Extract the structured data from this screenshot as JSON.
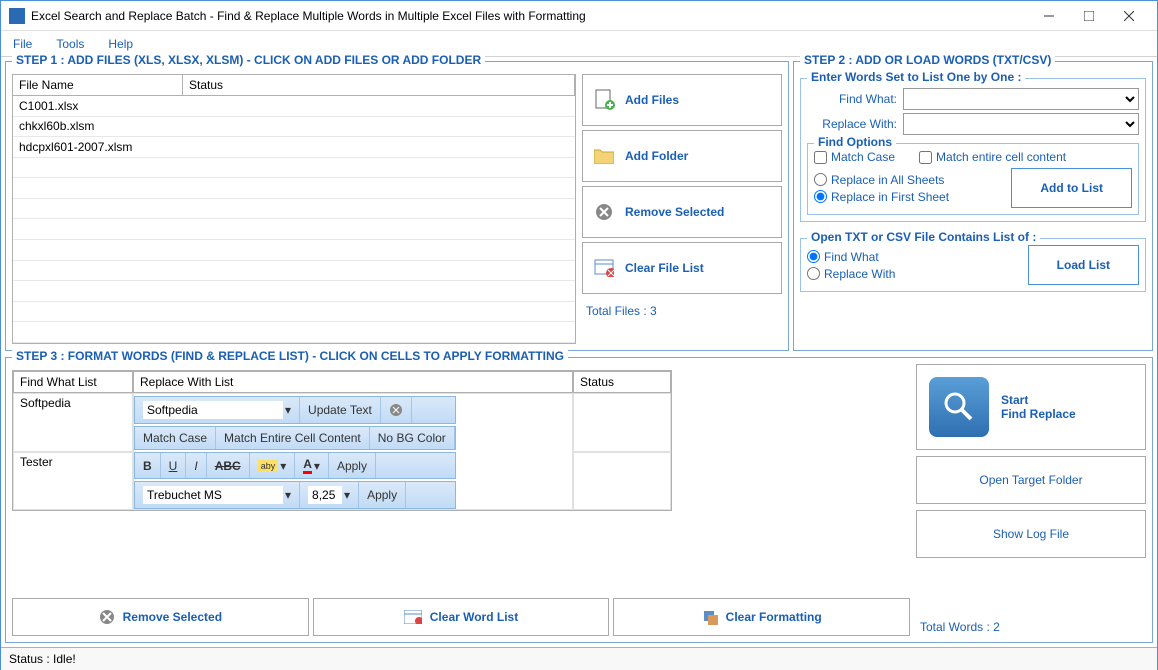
{
  "window": {
    "title": "Excel Search and Replace Batch - Find & Replace Multiple Words in Multiple Excel Files with Formatting"
  },
  "menu": [
    "File",
    "Tools",
    "Help"
  ],
  "step1": {
    "title": "STEP 1 : ADD FILES (XLS, XLSX, XLSM) - CLICK ON ADD FILES OR ADD FOLDER",
    "cols": [
      "File Name",
      "Status"
    ],
    "rows": [
      {
        "name": "C1001.xlsx",
        "status": ""
      },
      {
        "name": "chkxl60b.xlsm",
        "status": ""
      },
      {
        "name": "hdcpxl601-2007.xlsm",
        "status": ""
      }
    ],
    "btns": {
      "add_files": "Add Files",
      "add_folder": "Add Folder",
      "remove": "Remove Selected",
      "clear": "Clear File List"
    },
    "total": "Total Files : 3"
  },
  "step2": {
    "title": "STEP 2 : ADD OR LOAD WORDS (TXT/CSV)",
    "enter_title": "Enter Words Set to List One by One :",
    "find_what": "Find What:",
    "replace_with": "Replace With:",
    "opts_title": "Find Options",
    "match_case": "Match Case",
    "match_entire": "Match entire cell content",
    "replace_all": "Replace in All Sheets",
    "replace_first": "Replace in First Sheet",
    "add_list": "Add to List",
    "open_title": "Open TXT or CSV File Contains List of :",
    "ofw": "Find What",
    "orw": "Replace With",
    "load": "Load List"
  },
  "step3": {
    "title": "STEP 3 : FORMAT WORDS (FIND & REPLACE LIST) - CLICK ON CELLS TO APPLY FORMATTING",
    "cols": [
      "Find What List",
      "Replace With List",
      "Status"
    ],
    "rows": [
      {
        "find": "Softpedia",
        "replace_val": "Softpedia"
      },
      {
        "find": "Tester"
      }
    ],
    "fmt": {
      "update": "Update Text",
      "mc": "Match Case",
      "mec": "Match Entire Cell Content",
      "nobg": "No BG Color",
      "apply": "Apply",
      "font": "Trebuchet MS",
      "size": "8,25"
    },
    "bottom": {
      "remove": "Remove Selected",
      "clear_word": "Clear Word List",
      "clear_fmt": "Clear Formatting"
    },
    "right": {
      "start": "Start",
      "fr": "Find Replace",
      "open_target": "Open Target Folder",
      "show_log": "Show Log File",
      "total": "Total Words : 2"
    }
  },
  "status": "Status  :  Idle!"
}
